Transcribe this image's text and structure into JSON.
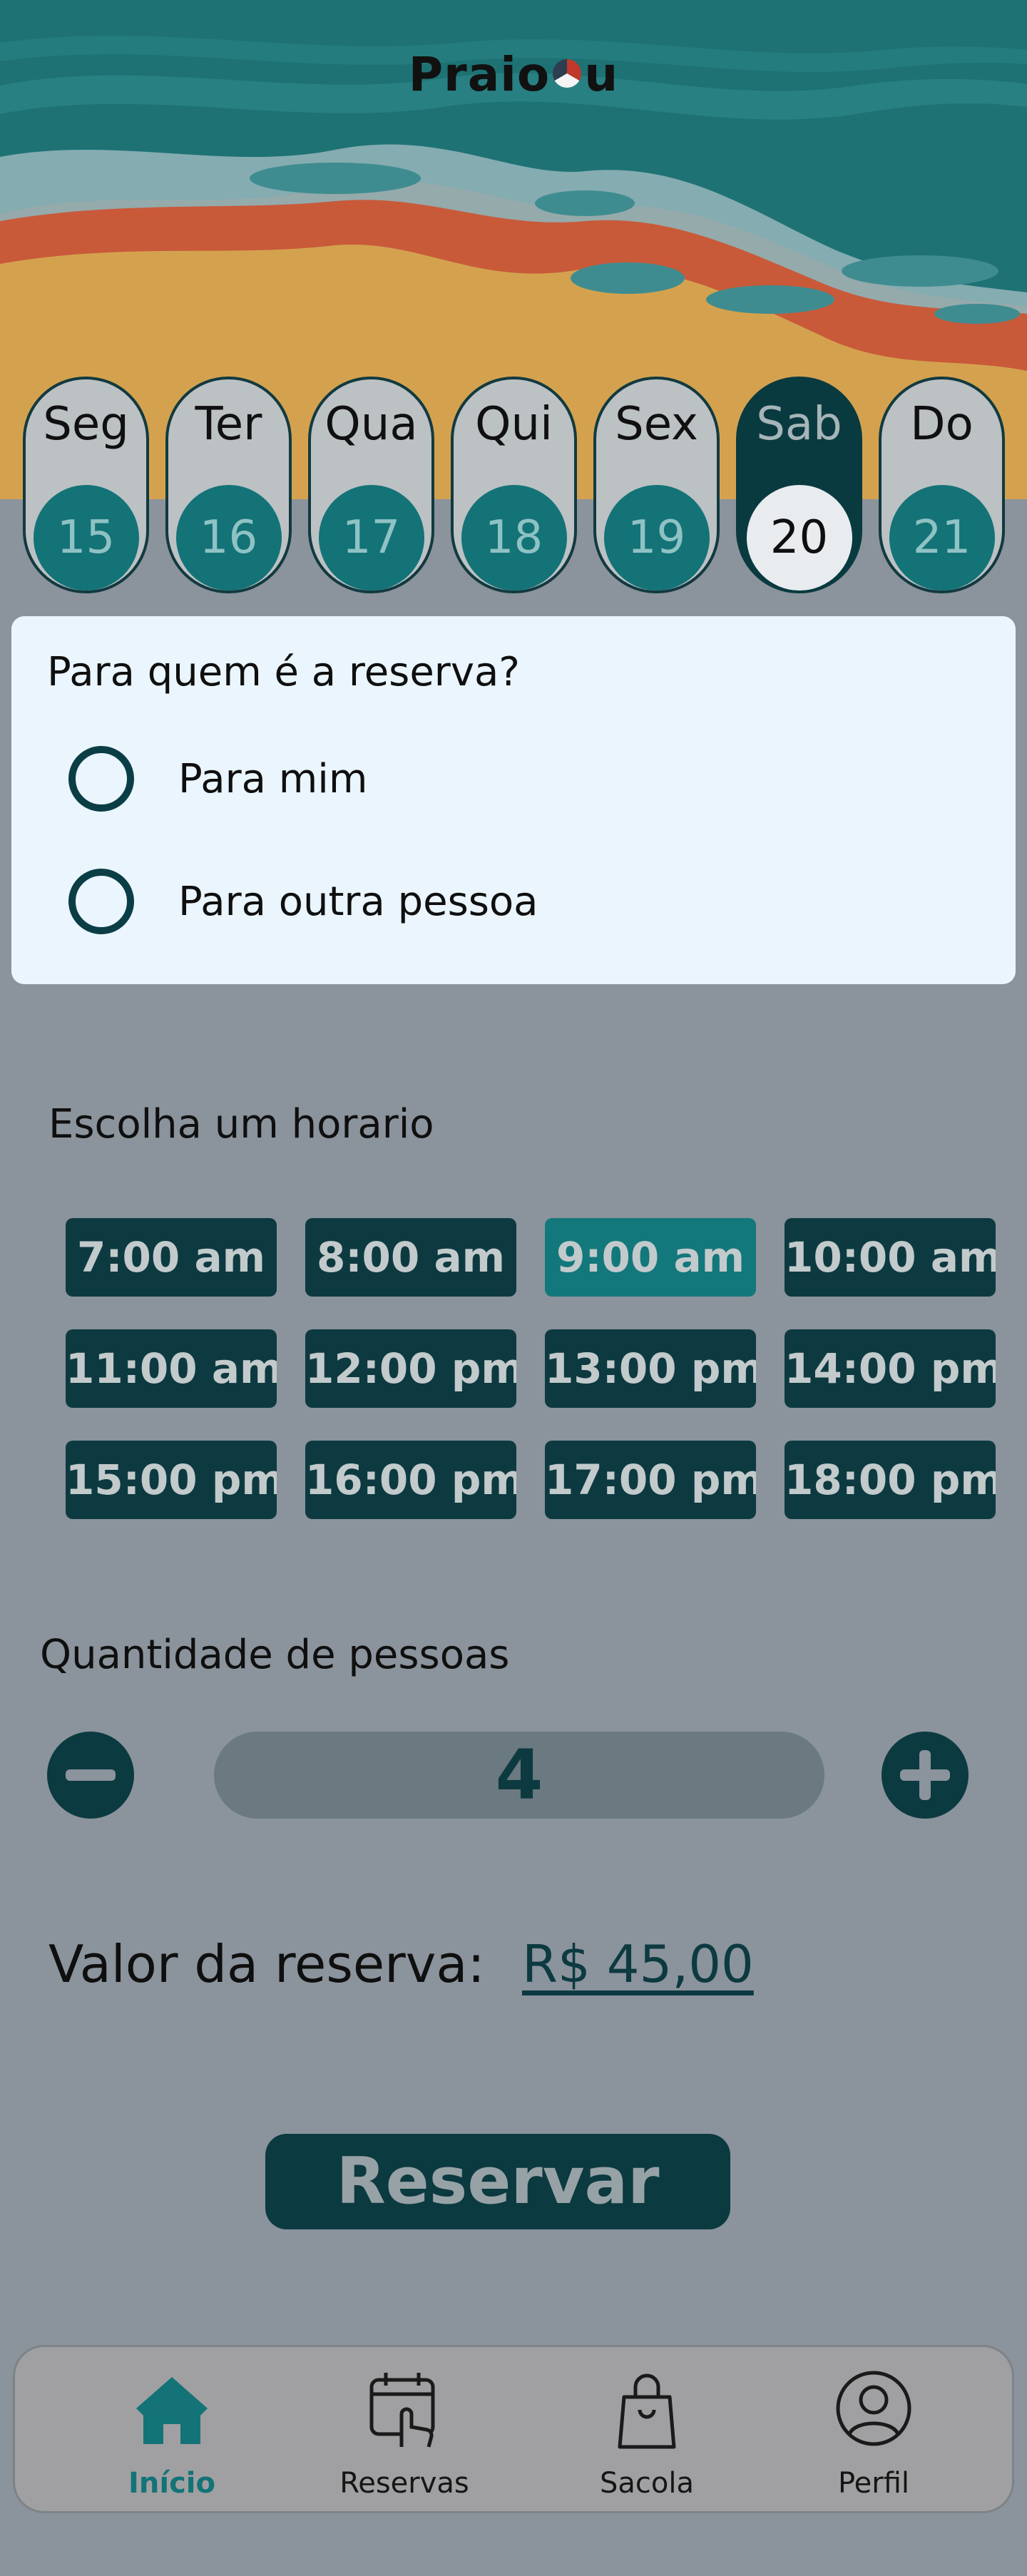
{
  "app": {
    "logo_text_left": "Praio",
    "logo_text_right": "u"
  },
  "days": [
    {
      "name": "Seg",
      "number": "15",
      "active": false
    },
    {
      "name": "Ter",
      "number": "16",
      "active": false
    },
    {
      "name": "Qua",
      "number": "17",
      "active": false
    },
    {
      "name": "Qui",
      "number": "18",
      "active": false
    },
    {
      "name": "Sex",
      "number": "19",
      "active": false
    },
    {
      "name": "Sab",
      "number": "20",
      "active": true
    },
    {
      "name": "Do",
      "number": "21",
      "active": false
    }
  ],
  "who": {
    "title": "Para quem é a reserva?",
    "options": [
      "Para mim",
      "Para outra pessoa"
    ]
  },
  "time": {
    "title": "Escolha um horario",
    "slots": [
      "7:00 am",
      "8:00 am",
      "9:00 am",
      "10:00 am",
      "11:00 am",
      "12:00 pm",
      "13:00 pm",
      "14:00 pm",
      "15:00 pm",
      "16:00 pm",
      "17:00 pm",
      "18:00 pm"
    ],
    "selected": "9:00 am"
  },
  "quantity": {
    "title": "Quantidade de pessoas",
    "value": "4"
  },
  "price": {
    "label": "Valor da reserva:",
    "amount": "R$ 45,00"
  },
  "reserve_label": "Reservar",
  "nav": [
    {
      "label": "Início",
      "icon": "home-icon",
      "active": true
    },
    {
      "label": "Reservas",
      "icon": "calendar-touch-icon",
      "active": false
    },
    {
      "label": "Sacola",
      "icon": "bag-icon",
      "active": false
    },
    {
      "label": "Perfil",
      "icon": "profile-icon",
      "active": false
    }
  ],
  "colors": {
    "primary": "#0b3a40",
    "accent": "#137377",
    "background": "#8b939c",
    "card": "#eaf5fd",
    "sand": "#d4a24f",
    "sea": "#2b7b7e"
  }
}
